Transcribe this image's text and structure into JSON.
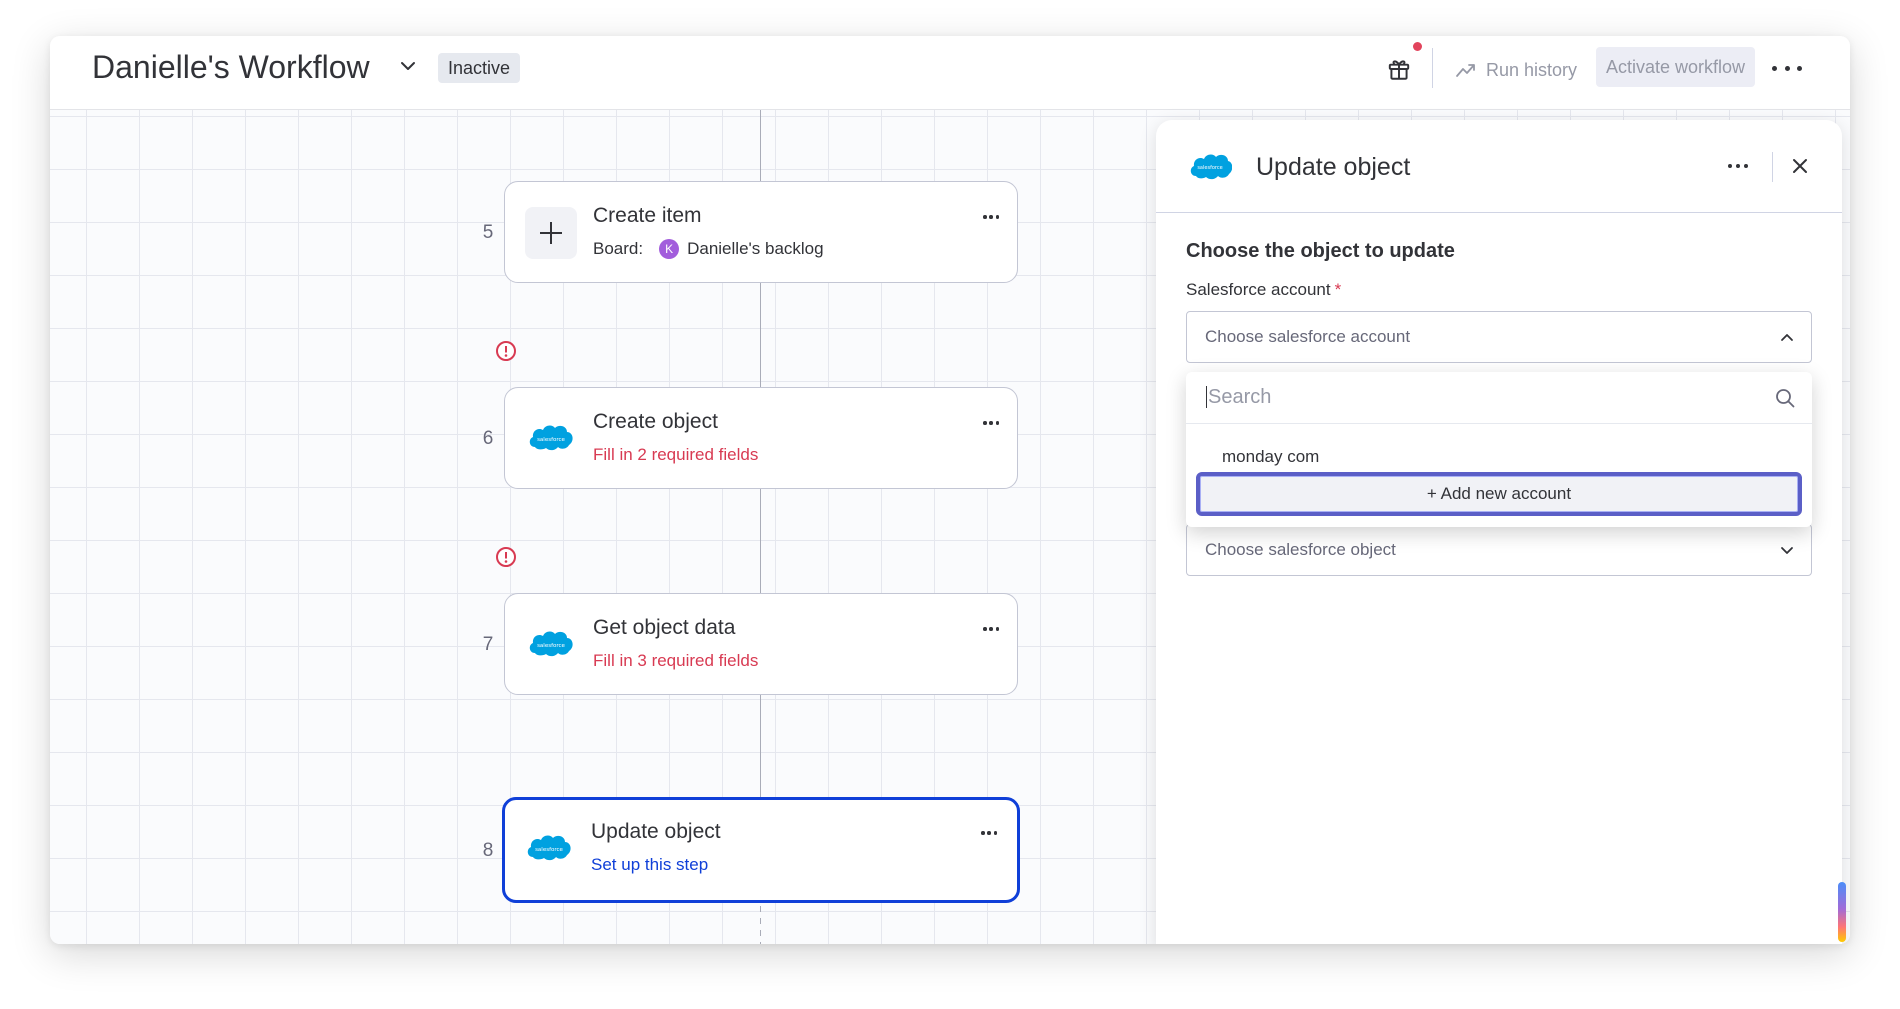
{
  "header": {
    "workflow_title": "Danielle's Workflow",
    "status_badge": "Inactive",
    "run_history": "Run history",
    "activate": "Activate workflow"
  },
  "steps": [
    {
      "number": "5",
      "title": "Create item",
      "board_label": "Board:",
      "board_avatar": "K",
      "board_name": "Danielle's backlog",
      "icon": "plus-icon"
    },
    {
      "number": "6",
      "title": "Create object",
      "subtitle": "Fill in 2 required fields",
      "icon": "salesforce-icon",
      "warning": true
    },
    {
      "number": "7",
      "title": "Get object data",
      "subtitle": "Fill in 3 required fields",
      "icon": "salesforce-icon",
      "warning": true
    },
    {
      "number": "8",
      "title": "Update object",
      "subtitle": "Set up this step",
      "icon": "salesforce-icon",
      "selected": true
    }
  ],
  "panel": {
    "logo_text": "salesforce",
    "title": "Update object",
    "section_title": "Choose the object to update",
    "account_label": "Salesforce account",
    "required_mark": "*",
    "account_placeholder": "Choose salesforce account",
    "search_placeholder": "Search",
    "options": [
      "monday com"
    ],
    "add_account": "+ Add new account",
    "object_placeholder": "Choose salesforce object"
  },
  "colors": {
    "accent_blue": "#0f3fd8",
    "error_red": "#d83a52",
    "focus_ring": "#5b5fc7",
    "salesforce_blue": "#00a1e0"
  }
}
